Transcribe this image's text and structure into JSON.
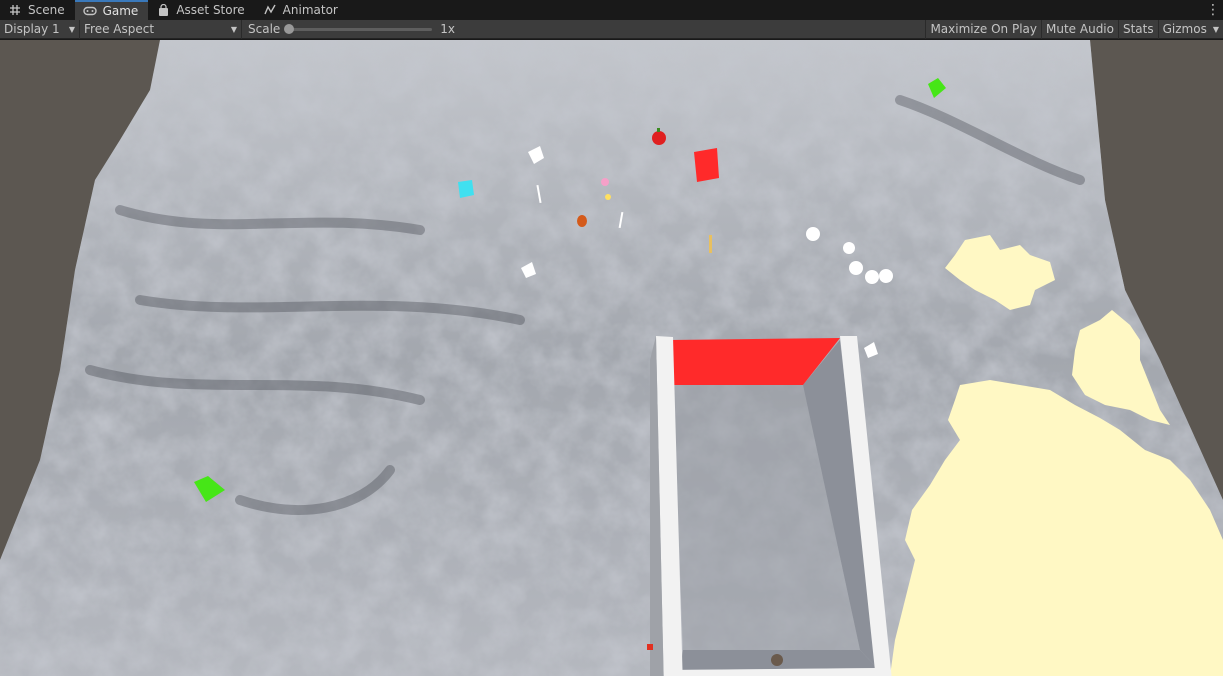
{
  "tabs": [
    {
      "label": "Scene",
      "icon": "grid-icon",
      "active": false
    },
    {
      "label": "Game",
      "icon": "gamepad-icon",
      "active": true
    },
    {
      "label": "Asset Store",
      "icon": "bag-icon",
      "active": false
    },
    {
      "label": "Animator",
      "icon": "animator-icon",
      "active": false
    }
  ],
  "toolbar": {
    "display": "Display 1",
    "aspect": "Free Aspect",
    "scale_label": "Scale",
    "scale_value": "1x",
    "scale_fraction": 0.0,
    "maximize": "Maximize On Play",
    "mute": "Mute Audio",
    "stats": "Stats",
    "gizmos": "Gizmos"
  },
  "colors": {
    "terrain": "#a8abb2",
    "terrain_dark": "#5f636c",
    "background": "#5c5751",
    "red_block": "#ff2a2a",
    "wall": "#f2f2f2",
    "wall_inner": "#8f939b",
    "sand": "#fff8c4",
    "green": "#46e617",
    "cyan": "#40e0f0",
    "accent": "#3a79bb"
  }
}
